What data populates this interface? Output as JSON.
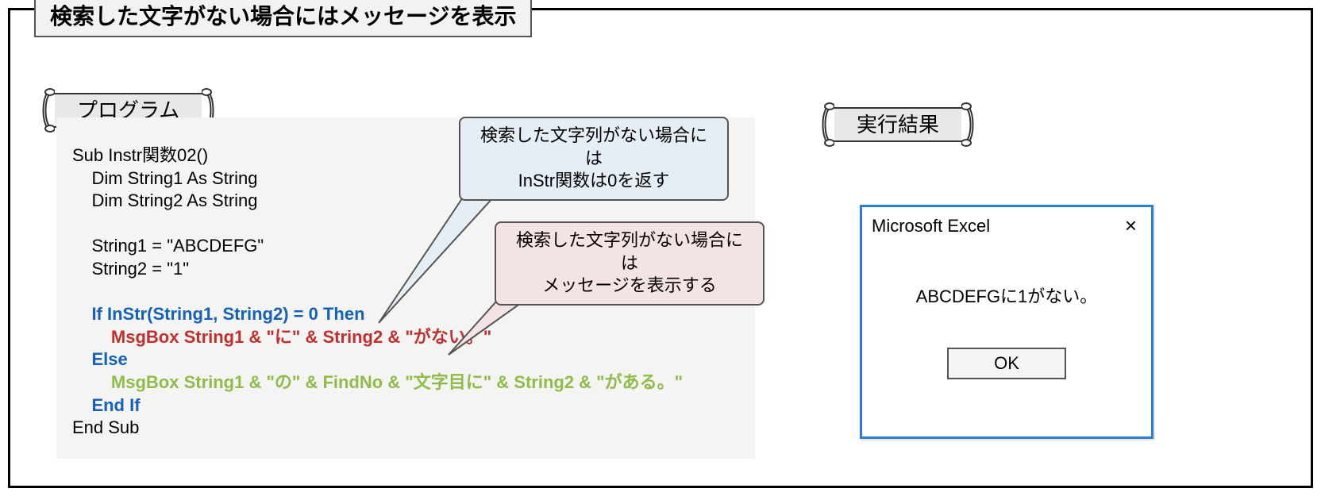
{
  "title": "検索した文字がない場合にはメッセージを表示",
  "banners": {
    "program": "プログラム",
    "result": "実行結果"
  },
  "code": {
    "l1": "Sub Instr関数02()",
    "l2": "    Dim String1 As String",
    "l3": "    Dim String2 As String",
    "l4": "",
    "l5": "    String1 = \"ABCDEFG\"",
    "l6": "    String2 = \"1\"",
    "l7": "",
    "l8": "    If InStr(String1, String2) = 0 Then",
    "l9": "        MsgBox String1 & \"に\" & String2 & \"がない。\"",
    "l10": "    Else",
    "l11": "        MsgBox String1 & \"の\" & FindNo & \"文字目に\" & String2 & \"がある。\"",
    "l12": "    End If",
    "l13": "End Sub"
  },
  "callouts": {
    "blue_l1": "検索した文字列がない場合には",
    "blue_l2": "InStr関数は0を返す",
    "pink_l1": "検索した文字列がない場合には",
    "pink_l2": "メッセージを表示する"
  },
  "msgbox": {
    "title": "Microsoft Excel",
    "close": "×",
    "body": "ABCDEFGに1がない。",
    "ok": "OK"
  }
}
